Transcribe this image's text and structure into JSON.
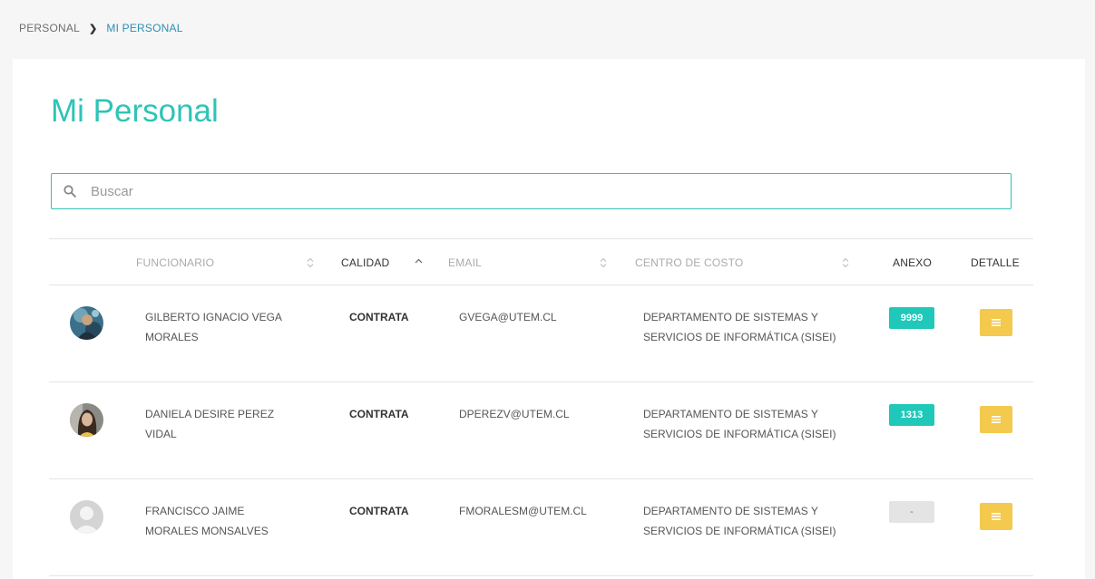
{
  "breadcrumb": {
    "root": "PERSONAL",
    "separator_icon": "chevron-right-icon",
    "current": "MI PERSONAL"
  },
  "page": {
    "title": "Mi Personal"
  },
  "search": {
    "placeholder": "Buscar",
    "value": "",
    "icon": "search-icon"
  },
  "table": {
    "headers": {
      "funcionario": "FUNCIONARIO",
      "calidad": "CALIDAD",
      "email": "EMAIL",
      "centro_costo": "CENTRO DE COSTO",
      "anexo": "ANEXO",
      "detalle": "DETALLE"
    },
    "rows": [
      {
        "name": "GILBERTO IGNACIO VEGA MORALES",
        "calidad": "CONTRATA",
        "email": "GVEGA@UTEM.CL",
        "centro_costo": "DEPARTAMENTO DE SISTEMAS Y SERVICIOS DE INFORMÁTICA (SISEI)",
        "anexo": "9999",
        "avatar": "photo-avatar"
      },
      {
        "name": "DANIELA DESIRE PEREZ VIDAL",
        "calidad": "CONTRATA",
        "email": "DPEREZV@UTEM.CL",
        "centro_costo": "DEPARTAMENTO DE SISTEMAS Y SERVICIOS DE INFORMÁTICA (SISEI)",
        "anexo": "1313",
        "avatar": "photo-avatar"
      },
      {
        "name": "FRANCISCO JAIME MORALES MONSALVES",
        "calidad": "CONTRATA",
        "email": "FMORALESM@UTEM.CL",
        "centro_costo": "DEPARTAMENTO DE SISTEMAS Y SERVICIOS DE INFORMÁTICA (SISEI)",
        "anexo": "-",
        "avatar": "default-avatar"
      }
    ]
  },
  "colors": {
    "accent": "#2ec4b6",
    "badge": "#1fc8b8",
    "detail_button": "#f3c94e",
    "breadcrumb_current": "#2a8fb3"
  }
}
